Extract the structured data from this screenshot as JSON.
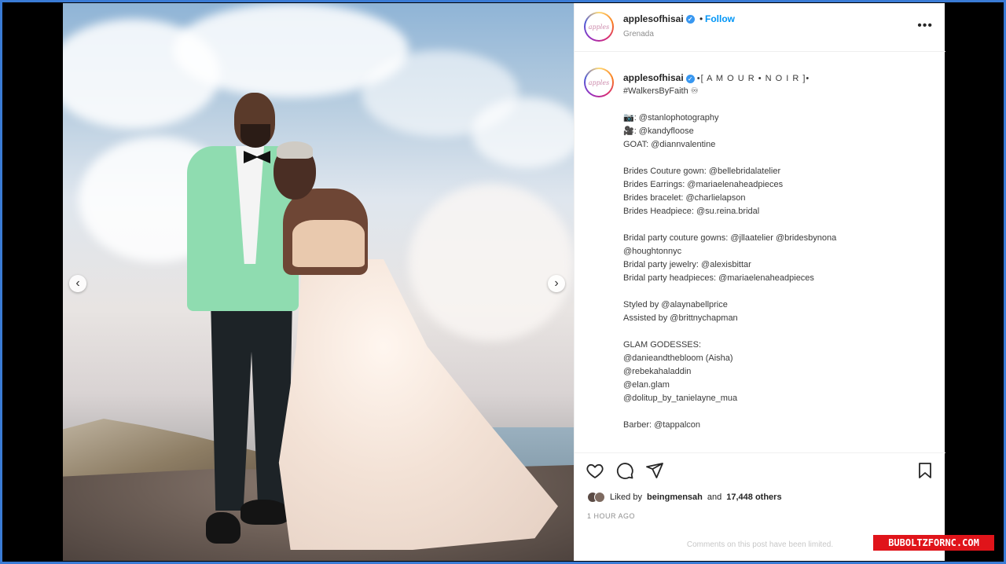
{
  "post": {
    "username": "applesofhisai",
    "location": "Grenada",
    "follow_label": "Follow",
    "separator": "•",
    "more_label": "•••",
    "avatar_text": "apples"
  },
  "caption": {
    "title": "•[ A M O U R • N O I R ]•",
    "lines": [
      "#WalkersByFaith ♾",
      "",
      "📷: @stanlophotography",
      "🎥: @kandyfloose",
      "GOAT: @diannvalentine",
      "",
      "Brides Couture gown: @bellebridalatelier",
      "Brides Earrings: @mariaelenaheadpieces",
      "Brides bracelet: @charlielapson",
      "Brides Headpiece: @su.reina.bridal",
      "",
      "Bridal party couture gowns: @jllaatelier @bridesbynona",
      "@houghtonnyc",
      "Bridal party jewelry: @alexisbittar",
      "Bridal party headpieces: @mariaelenaheadpieces",
      "",
      "Styled by @alaynabellprice",
      "Assisted by @brittnychapman",
      "",
      "GLAM GODESSES:",
      "@danieandthebloom (Aisha)",
      "@rebekahaladdin",
      "@elan.glam",
      "@dolitup_by_tanielayne_mua",
      "",
      "Barber: @tappalcon"
    ]
  },
  "likes": {
    "prefix": "Liked by",
    "user": "beingmensah",
    "middle": "and",
    "count": "17,448 others"
  },
  "timestamp": "1 HOUR AGO",
  "comments_notice": "Comments on this post have been limited.",
  "nav": {
    "prev": "‹",
    "next": "›"
  },
  "watermark": "BUBOLTZFORNC.COM",
  "colors": {
    "accent": "#0095f6",
    "verified": "#3897f0",
    "frame": "#3a7bd5",
    "watermark_bg": "#e0141a"
  }
}
